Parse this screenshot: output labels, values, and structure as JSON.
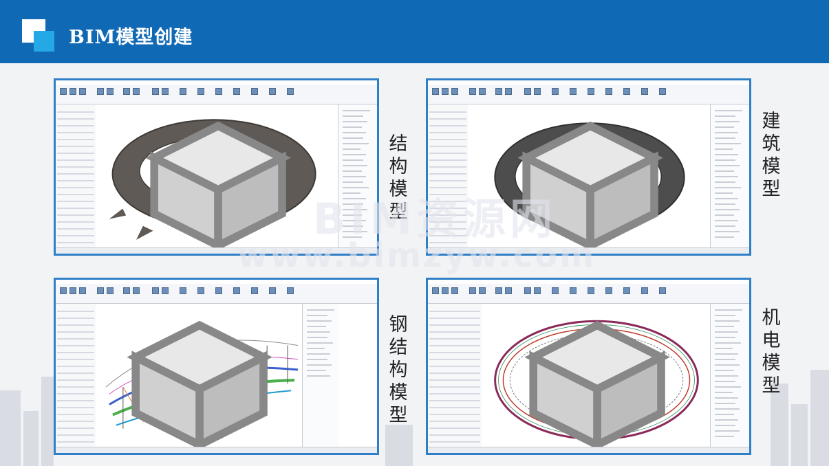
{
  "header": {
    "title": "BIM模型创建"
  },
  "panels": [
    {
      "id": "structure",
      "label": "结构模型"
    },
    {
      "id": "architecture",
      "label": "建筑模型"
    },
    {
      "id": "steel",
      "label": "钢结构模型"
    },
    {
      "id": "mep",
      "label": "机电模型"
    }
  ],
  "watermark": {
    "line1": "BIM资源网",
    "line2": "www.bimzyw.com"
  },
  "colors": {
    "header": "#1069b4",
    "accent": "#25a9e6",
    "frame": "#2f7fc7"
  }
}
